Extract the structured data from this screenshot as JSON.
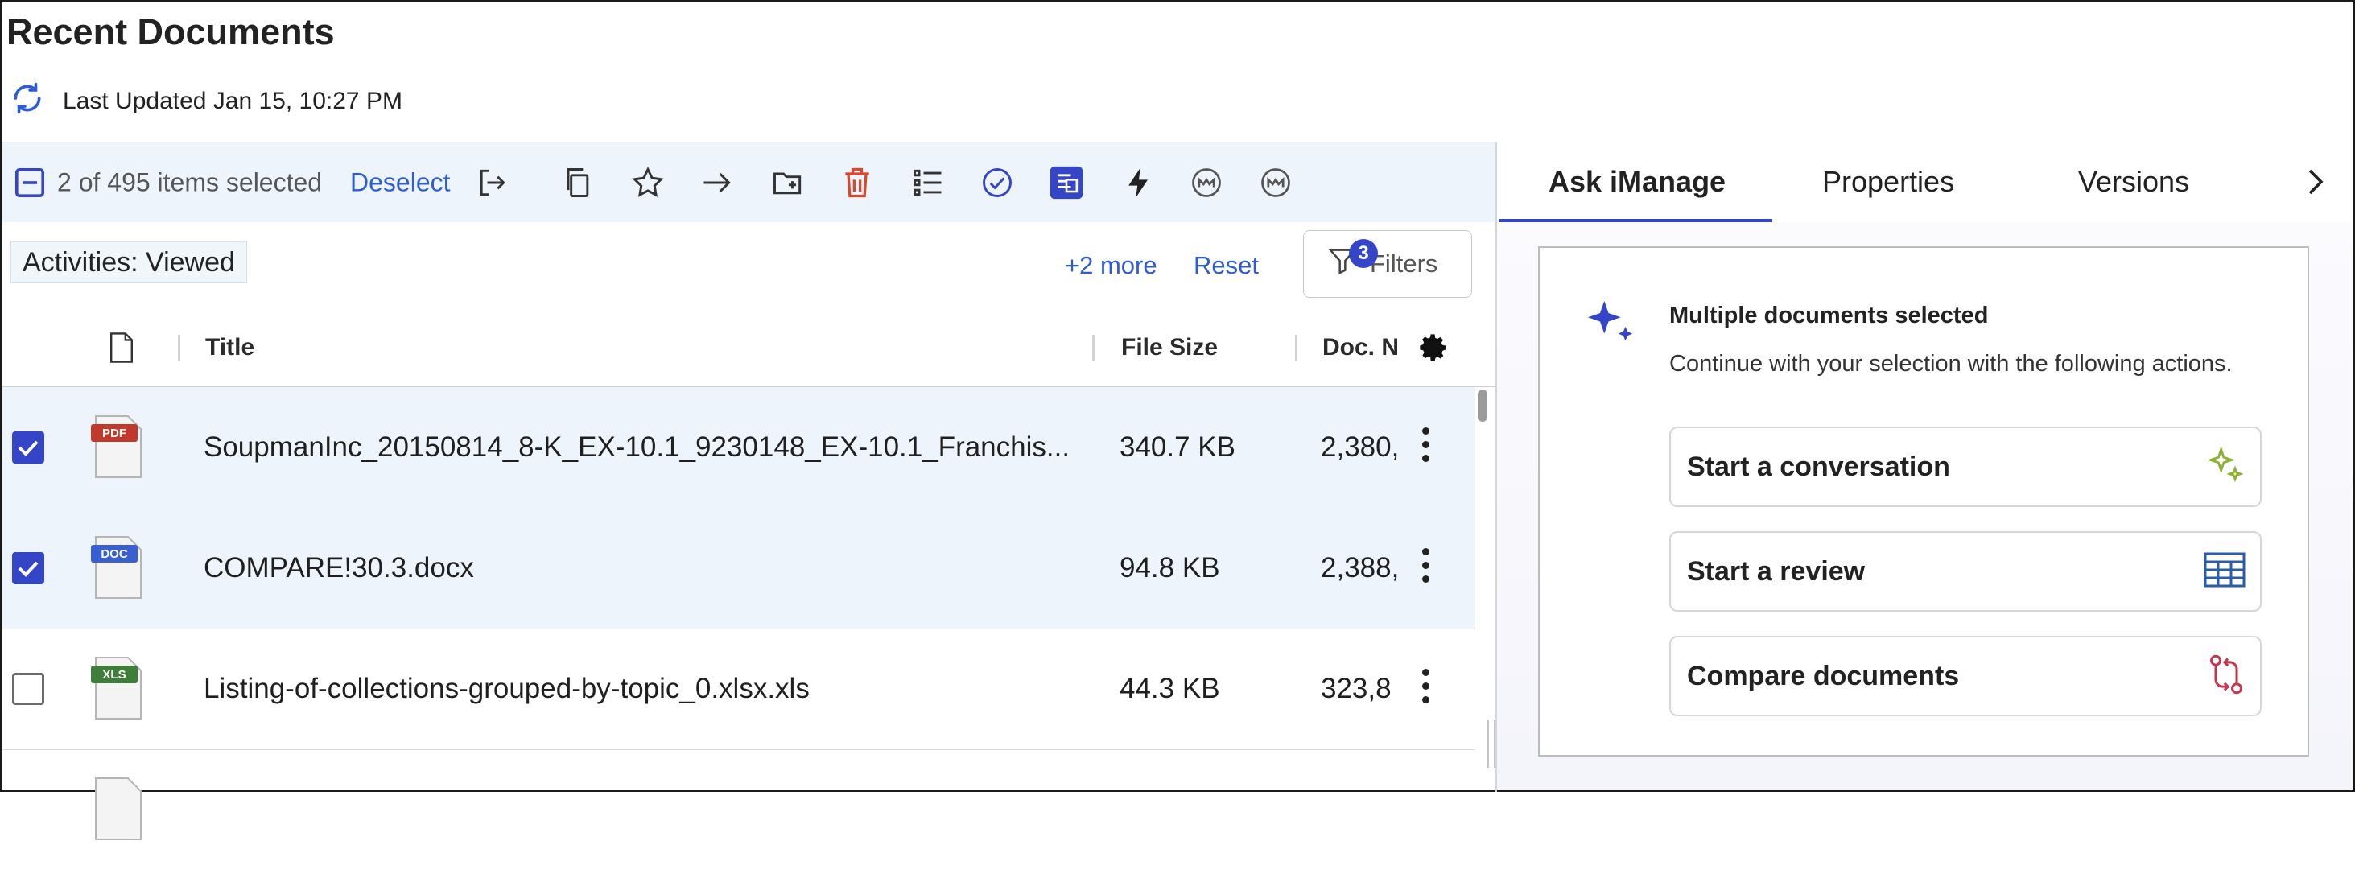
{
  "page": {
    "title": "Recent Documents",
    "last_updated": "Last Updated Jan 15, 10:27 PM"
  },
  "toolbar": {
    "selection": "2 of 495 items selected",
    "deselect": "Deselect"
  },
  "filters": {
    "chip": "Activities: Viewed",
    "more": "+2 more",
    "reset": "Reset",
    "button": "Filters",
    "count": "3"
  },
  "table": {
    "columns": [
      "Title",
      "File Size",
      "Doc. N"
    ],
    "rows": [
      {
        "type": "PDF",
        "title": "SoupmanInc_20150814_8-K_EX-10.1_9230148_EX-10.1_Franchis...",
        "size": "340.7 KB",
        "doc": "2,380,",
        "checked": true
      },
      {
        "type": "DOC",
        "title": "COMPARE!30.3.docx",
        "size": "94.8 KB",
        "doc": "2,388,",
        "checked": true
      },
      {
        "type": "XLS",
        "title": "Listing-of-collections-grouped-by-topic_0.xlsx.xls",
        "size": "44.3 KB",
        "doc": "323,8",
        "checked": false
      }
    ]
  },
  "panel": {
    "tabs": [
      "Ask iManage",
      "Properties",
      "Versions"
    ],
    "active_tab": "Ask iManage",
    "card_title": "Multiple documents selected",
    "card_desc": "Continue with your selection with the following actions.",
    "actions": [
      "Start a conversation",
      "Start a review",
      "Compare documents"
    ]
  },
  "colors": {
    "accent": "#3545c8",
    "link": "#2f5bd3",
    "delete": "#d9472f",
    "pdf": "#c0392b",
    "doc": "#3a5fd0",
    "xls": "#3f7d3a"
  }
}
